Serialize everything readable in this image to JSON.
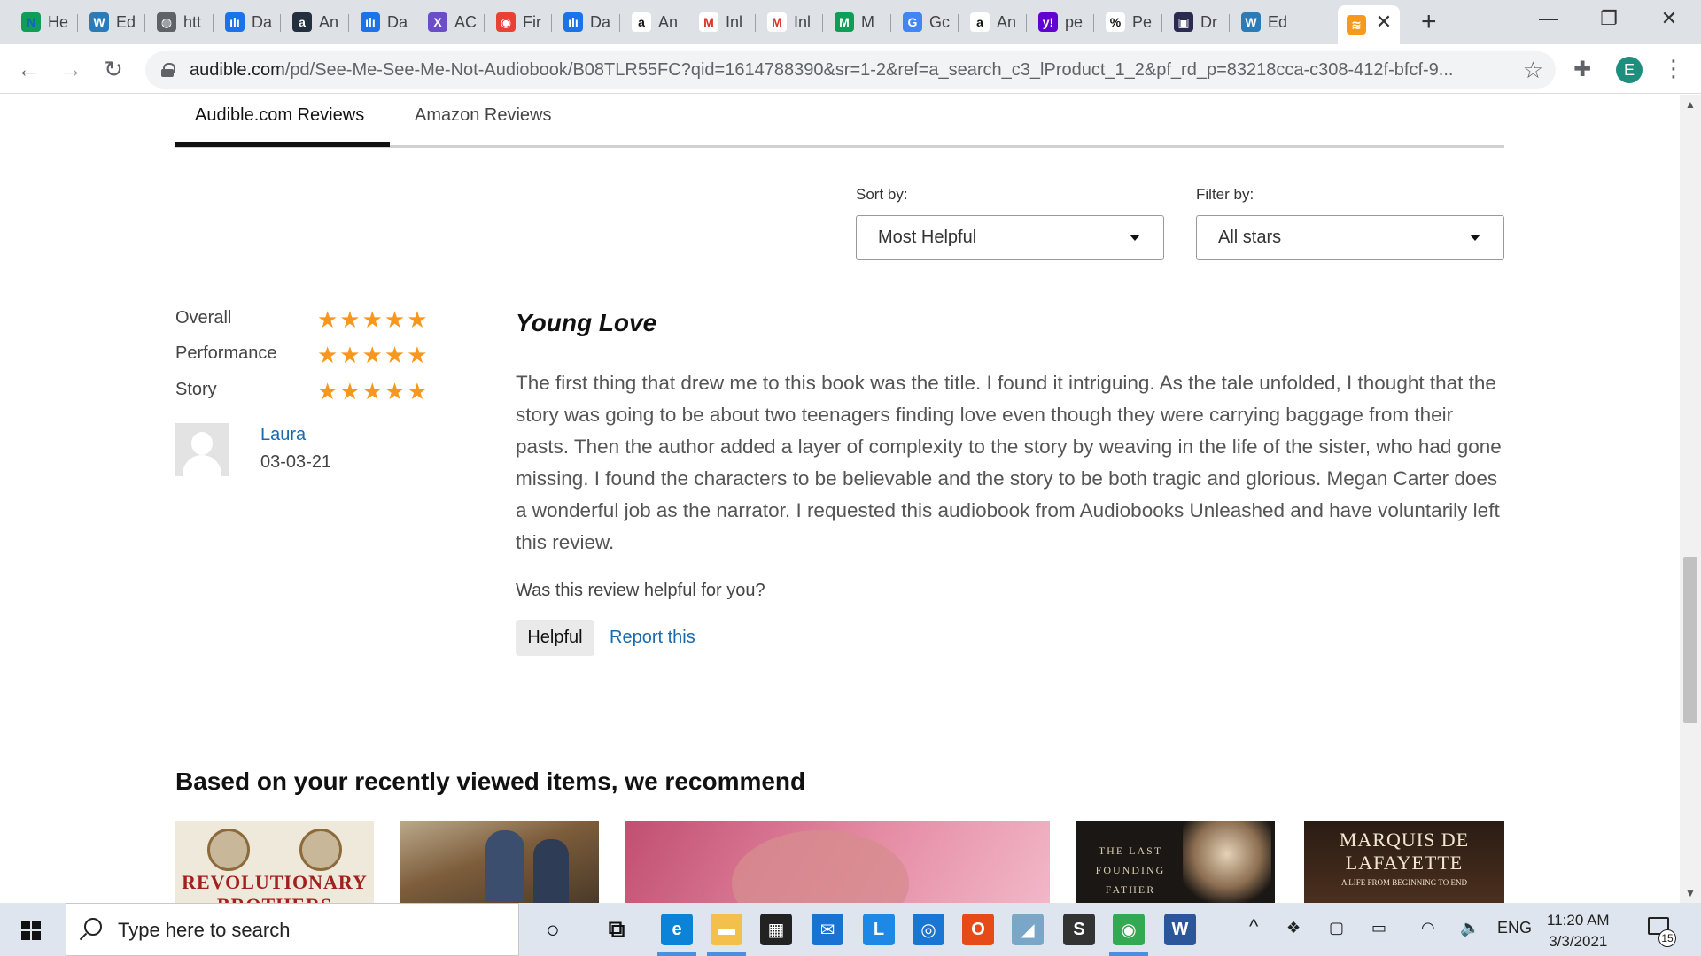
{
  "browser": {
    "tabs": [
      {
        "fav": "N",
        "favColor": "#0f9d58",
        "favTextColor": "#1565c0",
        "label": "He"
      },
      {
        "fav": "W",
        "favColor": "#2b7bb9",
        "label": "Ed"
      },
      {
        "fav": "◍",
        "favColor": "#5f6368",
        "label": "htt"
      },
      {
        "fav": "ılı",
        "favColor": "#1a73e8",
        "label": "Da"
      },
      {
        "fav": "a",
        "favColor": "#232f3e",
        "label": "An"
      },
      {
        "fav": "ılı",
        "favColor": "#1a73e8",
        "label": "Da"
      },
      {
        "fav": "X",
        "favColor": "#6b4cc9",
        "label": "AC"
      },
      {
        "fav": "◉",
        "favColor": "#e94235",
        "label": "Fir"
      },
      {
        "fav": "ılı",
        "favColor": "#1a73e8",
        "label": "Da"
      },
      {
        "fav": "a",
        "favColor": "#ffffff",
        "favTextColor": "#111111",
        "label": "An"
      },
      {
        "fav": "M",
        "favColor": "#ffffff",
        "favTextColor": "#d93025",
        "label": "Inl"
      },
      {
        "fav": "M",
        "favColor": "#ffffff",
        "favTextColor": "#d93025",
        "label": "Inl"
      },
      {
        "fav": "M",
        "favColor": "#0f9d58",
        "label": "M"
      },
      {
        "fav": "G",
        "favColor": "#4285f4",
        "label": "Gc"
      },
      {
        "fav": "a",
        "favColor": "#ffffff",
        "favTextColor": "#111111",
        "label": "An"
      },
      {
        "fav": "y!",
        "favColor": "#6001d2",
        "label": "pe"
      },
      {
        "fav": "%",
        "favColor": "#ffffff",
        "favTextColor": "#111111",
        "label": "Pe"
      },
      {
        "fav": "▣",
        "favColor": "#2b2b52",
        "label": "Dr"
      },
      {
        "fav": "W",
        "favColor": "#2b7bb9",
        "label": "Ed"
      }
    ],
    "active_tab": {
      "fav": "≋",
      "favColor": "#f7991c"
    },
    "close_glyph": "✕",
    "new_tab_glyph": "+",
    "minimize_glyph": "—",
    "restore_glyph": "❐",
    "window_close_glyph": "✕",
    "back_glyph": "←",
    "forward_glyph": "→",
    "reload_glyph": "↻",
    "url_host": "audible.com",
    "url_path": "/pd/See-Me-See-Me-Not-Audiobook/B08TLR55FC?qid=1614788390&sr=1-2&ref=a_search_c3_lProduct_1_2&pf_rd_p=83218cca-c308-412f-bfcf-9...",
    "star_glyph": "☆",
    "extensions_glyph": "✚",
    "profile_initial": "E",
    "menu_glyph": "⋮"
  },
  "reviews": {
    "tabs": [
      "Audible.com Reviews",
      "Amazon Reviews"
    ],
    "sort_label": "Sort by:",
    "sort_value": "Most Helpful",
    "filter_label": "Filter by:",
    "filter_value": "All stars",
    "ratings": [
      {
        "label": "Overall",
        "stars": 5
      },
      {
        "label": "Performance",
        "stars": 5
      },
      {
        "label": "Story",
        "stars": 5
      }
    ],
    "star_glyphs": "★★★★★",
    "reviewer": "Laura",
    "date": "03-03-21",
    "title": "Young Love",
    "body": "The first thing that drew me to this book was the title. I found it intriguing. As the tale unfolded, I thought that the story was going to be about two teenagers finding love even though they were carrying baggage from their pasts. Then the author added a layer of complexity to the story by weaving in the life of the sister, who had gone missing. I found the characters to be believable and the story to be both tragic and glorious. Megan Carter does a wonderful job as the narrator. I requested this audiobook from Audiobooks Unleashed and have voluntarily left this review.",
    "helpful_question": "Was this review helpful for you?",
    "helpful_button": "Helpful",
    "report_link": "Report this"
  },
  "recommendations": {
    "heading": "Based on your recently viewed items, we recommend",
    "covers": [
      {
        "text": "REVOLUTIONARY BROTHERS",
        "bg": "#efe9dc",
        "color": "#a0211d"
      },
      {
        "text": "",
        "bg": "#8a6e4e",
        "color": "#ffffff"
      },
      {
        "text": "",
        "bg": "#d5728e",
        "color": "#ffffff"
      },
      {
        "text": "THE LAST FOUNDING FATHER",
        "bg": "#1b1714",
        "color": "#d9cdb0"
      },
      {
        "text": "MARQUIS DE LAFAYETTE",
        "sub": "A LIFE FROM BEGINNING TO END",
        "bg": "#3a2418",
        "color": "#f1e6d0"
      }
    ]
  },
  "taskbar": {
    "search_placeholder": "Type here to search",
    "apps": [
      {
        "name": "cortana-icon",
        "glyph": "○",
        "color": "transparent",
        "text": "#111111"
      },
      {
        "name": "task-view-icon",
        "glyph": "⧉",
        "color": "transparent",
        "text": "#111111"
      },
      {
        "name": "edge-icon",
        "glyph": "e",
        "color": "#0b84d8"
      },
      {
        "name": "file-explorer-icon",
        "glyph": "▬",
        "color": "#f3c14b"
      },
      {
        "name": "store-icon",
        "glyph": "▦",
        "color": "#222222"
      },
      {
        "name": "mail-icon",
        "glyph": "✉",
        "color": "#1873d3"
      },
      {
        "name": "l-app-icon",
        "glyph": "L",
        "color": "#1e88e5"
      },
      {
        "name": "circle-app-icon",
        "glyph": "◎",
        "color": "#1976d2"
      },
      {
        "name": "office-icon",
        "glyph": "O",
        "color": "#e64a19"
      },
      {
        "name": "paper-app-icon",
        "glyph": "◢",
        "color": "#7aa7c7"
      },
      {
        "name": "s-app-icon",
        "glyph": "S",
        "color": "#333333"
      },
      {
        "name": "chrome-icon",
        "glyph": "◉",
        "color": "#34a853"
      },
      {
        "name": "word-icon",
        "glyph": "W",
        "color": "#2b579a"
      }
    ],
    "tray": {
      "chevron": "^",
      "dropbox": "❖",
      "screen": "▢",
      "battery": "▭",
      "wifi": "◠",
      "volume": "🔈",
      "language": "ENG"
    },
    "time": "11:20 AM",
    "date": "3/3/2021",
    "notification_count": "15"
  }
}
